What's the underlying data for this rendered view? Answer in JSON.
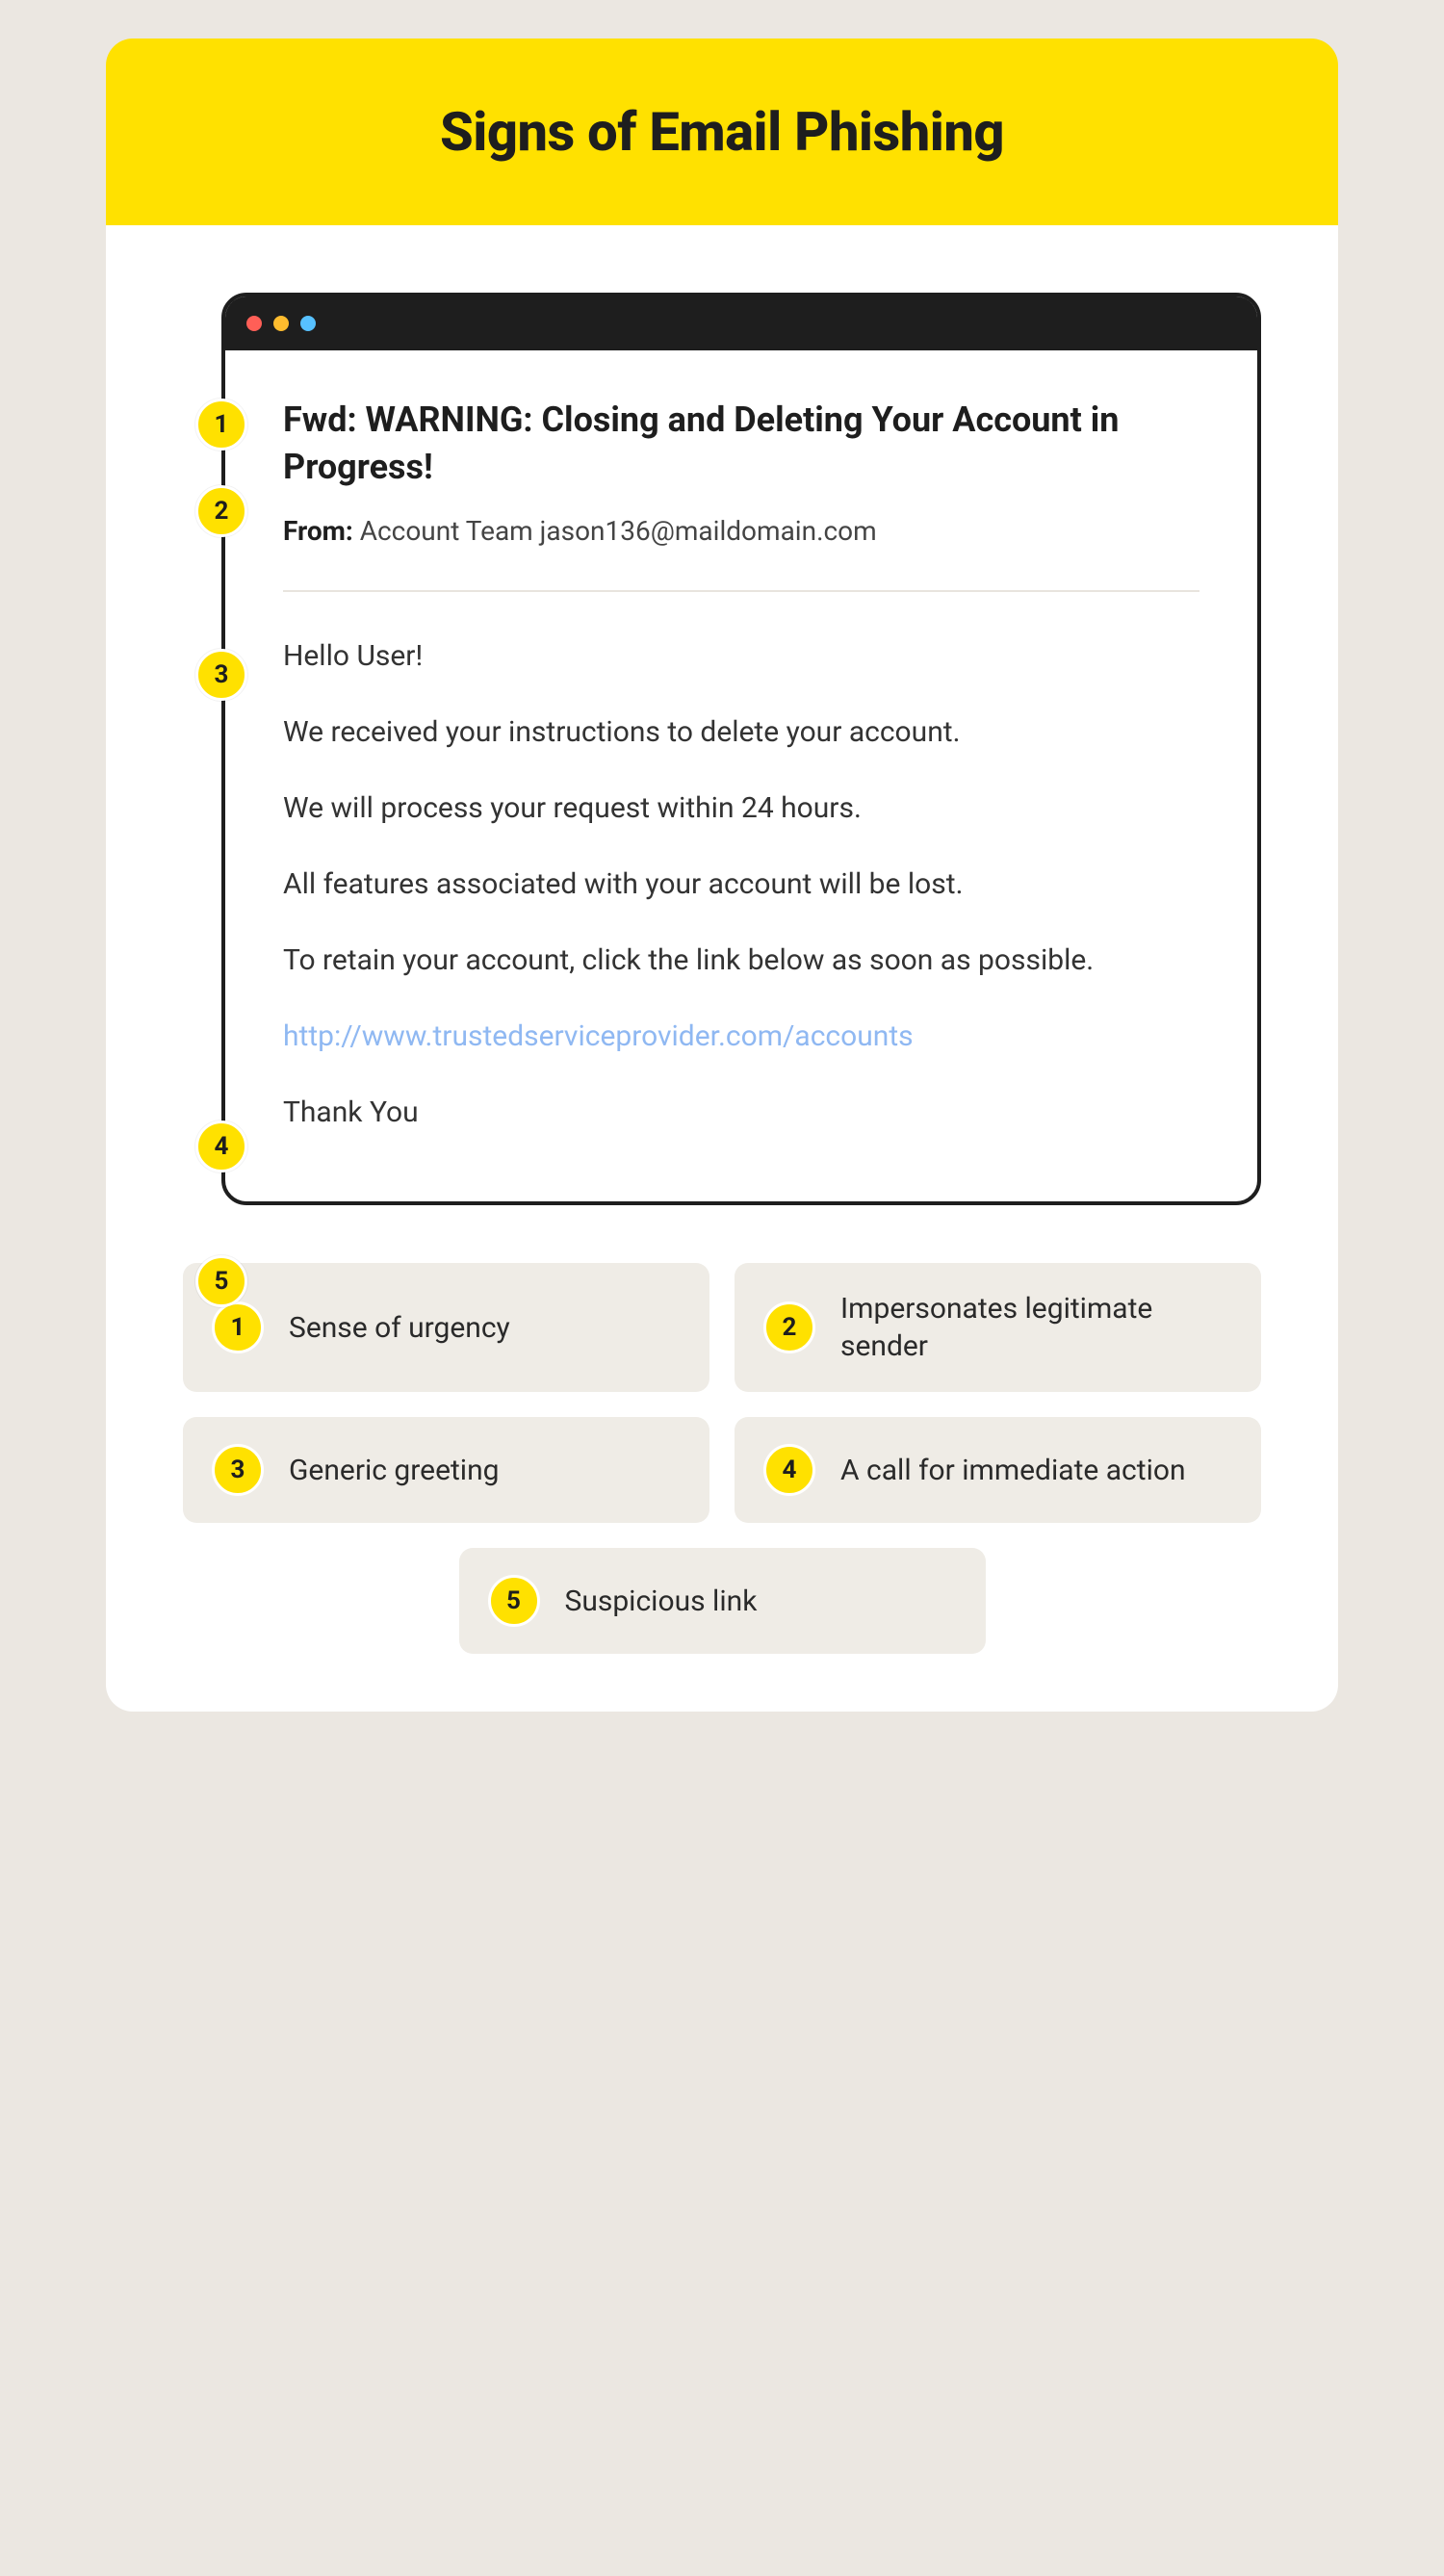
{
  "title": "Signs of Email Phishing",
  "email": {
    "subject": "Fwd: WARNING: Closing and Deleting Your Account in Progress!",
    "from_label": "From:",
    "from_value": "Account Team jason136@maildomain.com",
    "greeting": "Hello User!",
    "p1": "We received your instructions to delete your account.",
    "p2": "We will process your request within 24 hours.",
    "p3": "All features associated with your account will be lost.",
    "p4": "To retain your account, click the link below as soon as possible.",
    "link": "http://www.trustedserviceprovider.com/accounts",
    "signoff": "Thank You"
  },
  "markers": {
    "m1": "1",
    "m2": "2",
    "m3": "3",
    "m4": "4",
    "m5": "5"
  },
  "legend": [
    {
      "n": "1",
      "label": "Sense of urgency"
    },
    {
      "n": "2",
      "label": "Impersonates legitimate sender"
    },
    {
      "n": "3",
      "label": "Generic greeting"
    },
    {
      "n": "4",
      "label": "A call for immediate action"
    },
    {
      "n": "5",
      "label": "Suspicious link"
    }
  ]
}
